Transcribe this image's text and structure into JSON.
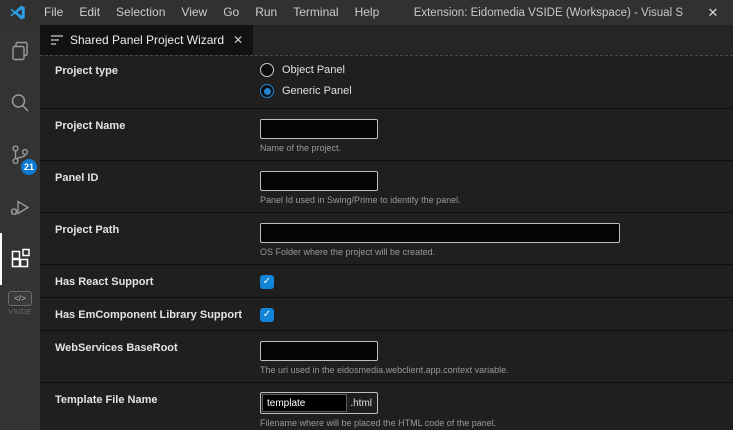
{
  "titlebar": {
    "menus": [
      "File",
      "Edit",
      "Selection",
      "View",
      "Go",
      "Run",
      "Terminal",
      "Help"
    ],
    "title": "Extension: Eidomedia VSIDE (Workspace) - Visual S",
    "close_glyph": "✕"
  },
  "activity_bar": {
    "source_control_badge": "21",
    "vside_glyph": "</>",
    "vside_label": "VSIDE"
  },
  "editor": {
    "tab": {
      "title": "Shared Panel Project Wizard",
      "close_glyph": "✕"
    }
  },
  "form": {
    "rows": [
      {
        "label": "Project type",
        "options": [
          {
            "label": "Object Panel",
            "selected": false
          },
          {
            "label": "Generic Panel",
            "selected": true
          }
        ]
      },
      {
        "label": "Project Name",
        "value": "",
        "help": "Name of the project."
      },
      {
        "label": "Panel ID",
        "value": "",
        "help": "Panel Id used in Swing/Prime to identify the panel."
      },
      {
        "label": "Project Path",
        "value": "",
        "help": "OS Folder where the project will be created."
      },
      {
        "label": "Has React Support",
        "checked": true,
        "check_glyph": "✓"
      },
      {
        "label": "Has EmComponent Library Support",
        "checked": true,
        "check_glyph": "✓"
      },
      {
        "label": "WebServices BaseRoot",
        "value": "",
        "help": "The uri used in the eidosmedia.webclient.app.context variable."
      },
      {
        "label": "Template File Name",
        "value": "template",
        "suffix": ".html",
        "help": "Filename where will be placed the HTML code of the panel."
      }
    ]
  },
  "colors": {
    "accent_blue": "#0e7ad3",
    "checkbox_blue": "#1385d8",
    "radio_blue": "#2086d3"
  }
}
